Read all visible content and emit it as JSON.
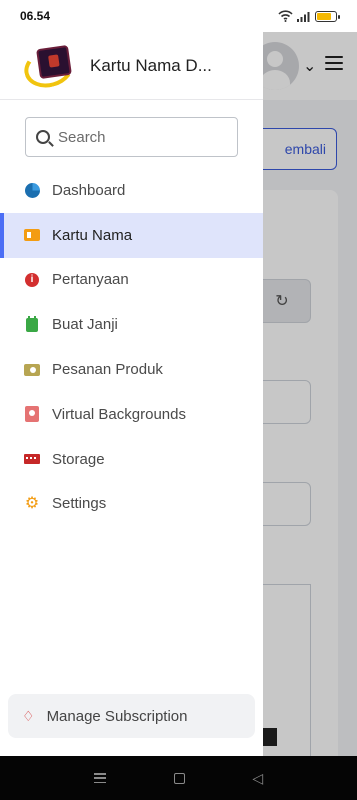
{
  "status_bar": {
    "time": "06.54",
    "battery_level": 0.8,
    "battery_color": "#f5b800"
  },
  "drawer": {
    "app_title": "Kartu Nama D...",
    "search": {
      "placeholder": "Search",
      "value": ""
    },
    "menu_items": [
      {
        "label": "Dashboard",
        "icon": "pie-chart-icon",
        "active": false
      },
      {
        "label": "Kartu Nama",
        "icon": "id-card-icon",
        "active": true
      },
      {
        "label": "Pertanyaan",
        "icon": "info-icon",
        "active": false
      },
      {
        "label": "Buat Janji",
        "icon": "calendar-icon",
        "active": false
      },
      {
        "label": "Pesanan Produk",
        "icon": "money-icon",
        "active": false
      },
      {
        "label": "Virtual Backgrounds",
        "icon": "id-badge-icon",
        "active": false
      },
      {
        "label": "Storage",
        "icon": "memory-icon",
        "active": false
      },
      {
        "label": "Settings",
        "icon": "gear-icon",
        "active": false
      }
    ],
    "manage_subscription": {
      "label": "Manage Subscription",
      "icon": "gem-icon"
    }
  },
  "background": {
    "kembali_label": "embali"
  },
  "colors": {
    "accent": "#4c6ef5",
    "active_bg": "#dfe4fb"
  }
}
